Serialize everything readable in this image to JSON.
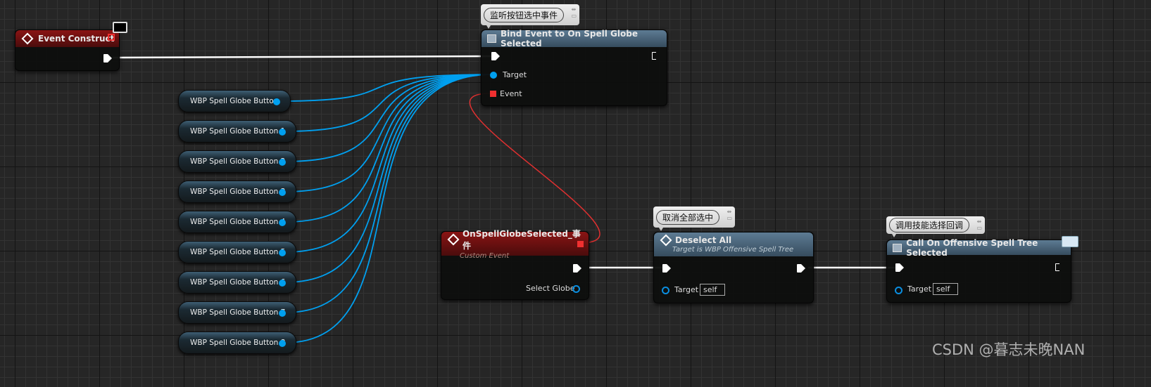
{
  "event_construct": {
    "title": "Event Construct",
    "icon": "event-diamond-icon"
  },
  "bind_node": {
    "comment": "监听按钮选中事件",
    "title": "Bind Event to On Spell Globe Selected",
    "pins": {
      "target": "Target",
      "event": "Event"
    }
  },
  "variables": [
    "WBP Spell Globe Button",
    "WBP Spell Globe Button 1",
    "WBP Spell Globe Button 2",
    "WBP Spell Globe Button 3",
    "WBP Spell Globe Button 4",
    "WBP Spell Globe Button 5",
    "WBP Spell Globe Button 6",
    "WBP Spell Globe Button 7",
    "WBP Spell Globe Button 8"
  ],
  "custom_event": {
    "title": "OnSpellGlobeSelected_事件",
    "subtitle": "Custom Event",
    "pin": "Select Globe"
  },
  "deselect": {
    "comment": "取消全部选中",
    "title": "Deselect All",
    "subtitle": "Target is WBP Offensive Spell Tree",
    "target_label": "Target",
    "target_value": "self"
  },
  "call_node": {
    "comment": "调用技能选择回调",
    "title": "Call On Offensive Spell Tree Selected",
    "target_label": "Target",
    "target_value": "self"
  },
  "watermark": "CSDN @暮志未晚NAN",
  "colors": {
    "exec_wire": "#ffffff",
    "object_wire": "#00a0f0",
    "delegate_wire": "#e03030",
    "event_header": "#8a1414",
    "function_header": "#5d7b93"
  }
}
